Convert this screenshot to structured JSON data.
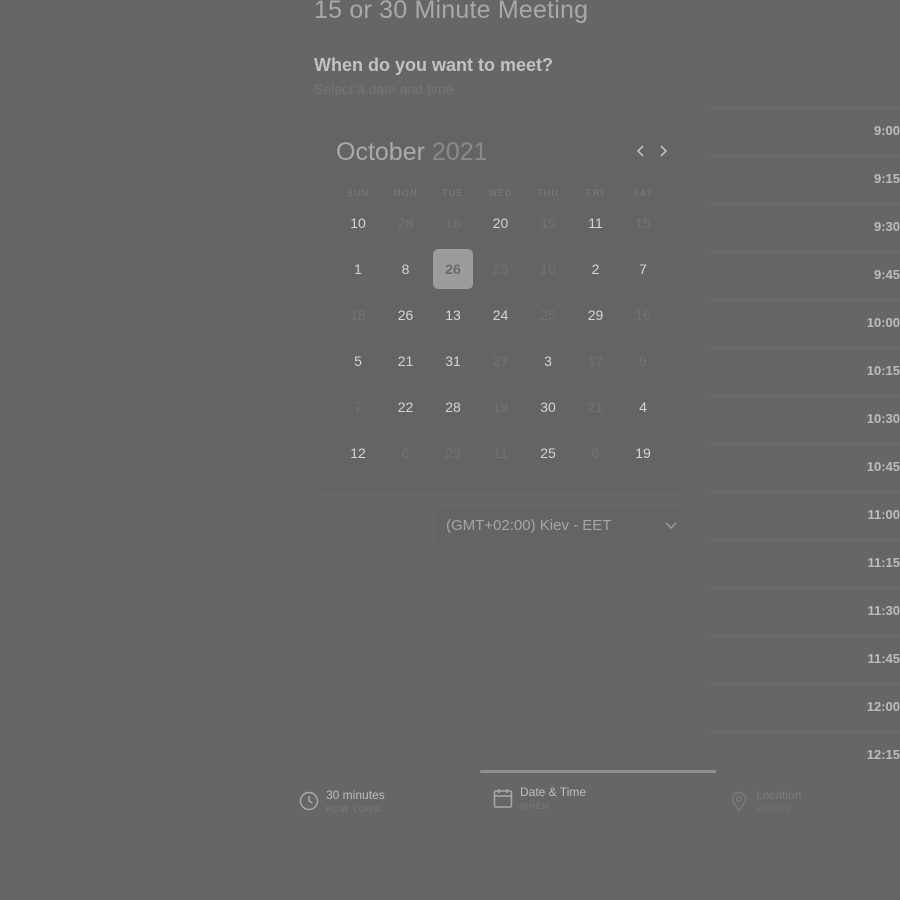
{
  "page": {
    "title": "15 or 30 Minute Meeting",
    "question": "When do you want to meet?",
    "question_sub": "Select a date and time"
  },
  "calendar": {
    "month": "October",
    "year": "2021",
    "weekdays": [
      "SUN",
      "MON",
      "TUE",
      "WED",
      "THU",
      "FRI",
      "SAT"
    ],
    "selected_day": "26",
    "rows": [
      [
        {
          "d": "10",
          "dim": false
        },
        {
          "d": "28",
          "dim": true
        },
        {
          "d": "16",
          "dim": true
        },
        {
          "d": "20",
          "dim": false
        },
        {
          "d": "15",
          "dim": true
        },
        {
          "d": "11",
          "dim": false
        },
        {
          "d": "15",
          "dim": true
        }
      ],
      [
        {
          "d": "1",
          "dim": false
        },
        {
          "d": "8",
          "dim": false
        },
        {
          "d": "26",
          "dim": false,
          "sel": true
        },
        {
          "d": "25",
          "dim": true
        },
        {
          "d": "10",
          "dim": true
        },
        {
          "d": "2",
          "dim": false
        },
        {
          "d": "7",
          "dim": false
        }
      ],
      [
        {
          "d": "18",
          "dim": true
        },
        {
          "d": "26",
          "dim": false
        },
        {
          "d": "13",
          "dim": false
        },
        {
          "d": "24",
          "dim": false
        },
        {
          "d": "25",
          "dim": true
        },
        {
          "d": "29",
          "dim": false
        },
        {
          "d": "16",
          "dim": true
        }
      ],
      [
        {
          "d": "5",
          "dim": false
        },
        {
          "d": "21",
          "dim": false
        },
        {
          "d": "31",
          "dim": false
        },
        {
          "d": "27",
          "dim": true
        },
        {
          "d": "3",
          "dim": false
        },
        {
          "d": "17",
          "dim": true
        },
        {
          "d": "9",
          "dim": true
        }
      ],
      [
        {
          "d": "7",
          "dim": true
        },
        {
          "d": "22",
          "dim": false
        },
        {
          "d": "28",
          "dim": false
        },
        {
          "d": "19",
          "dim": true
        },
        {
          "d": "30",
          "dim": false
        },
        {
          "d": "21",
          "dim": true
        },
        {
          "d": "4",
          "dim": false
        }
      ],
      [
        {
          "d": "12",
          "dim": false
        },
        {
          "d": "6",
          "dim": true
        },
        {
          "d": "29",
          "dim": true
        },
        {
          "d": "11",
          "dim": true
        },
        {
          "d": "25",
          "dim": false
        },
        {
          "d": "6",
          "dim": true
        },
        {
          "d": "19",
          "dim": false
        }
      ]
    ]
  },
  "timezone": {
    "label": "(GMT+02:00) Kiev - EET"
  },
  "time_slots": [
    "9:00",
    "9:15",
    "9:30",
    "9:45",
    "10:00",
    "10:15",
    "10:30",
    "10:45",
    "11:00",
    "11:15",
    "11:30",
    "11:45",
    "12:00",
    "12:15"
  ],
  "steps": [
    {
      "title": "30 minutes",
      "sub": "HOW LONG",
      "icon": "clock-icon"
    },
    {
      "title": "Date & Time",
      "sub": "WHEN",
      "icon": "calendar-icon"
    },
    {
      "title": "Location",
      "sub": "WHERE",
      "icon": "location-pin-icon"
    }
  ]
}
